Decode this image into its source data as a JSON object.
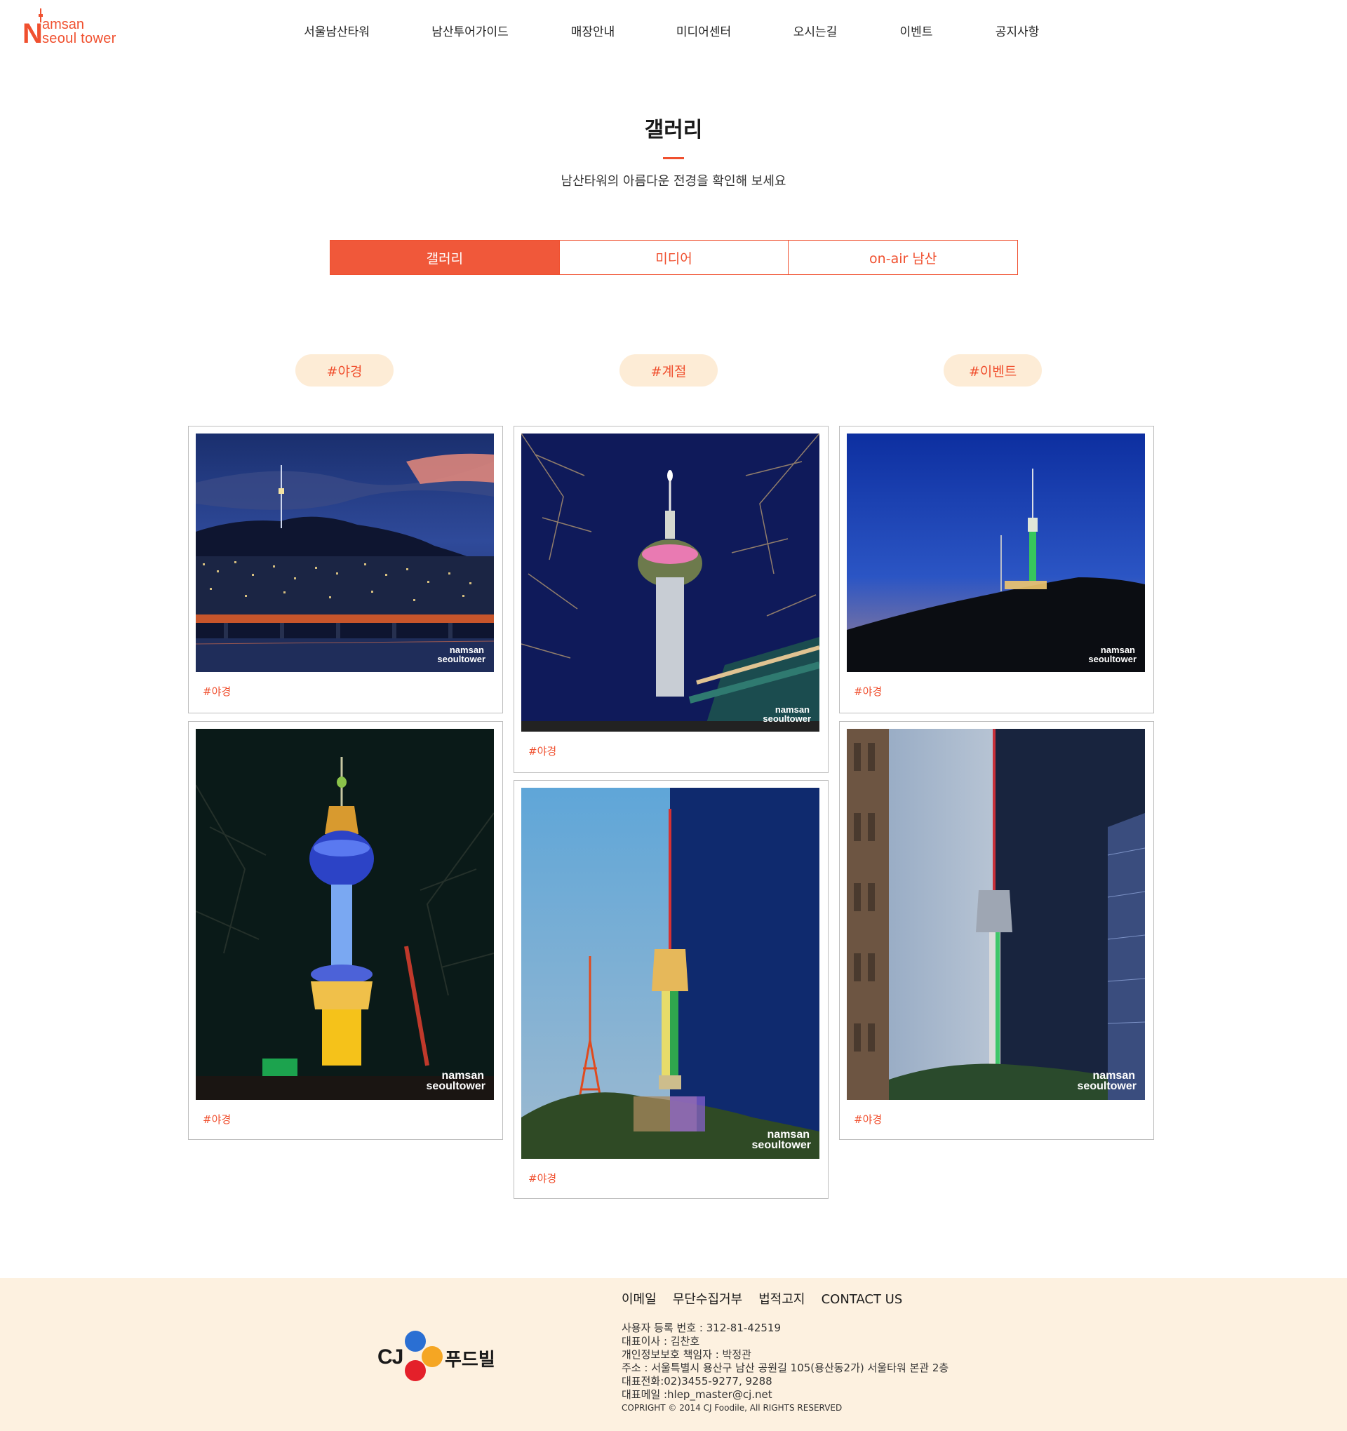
{
  "header": {
    "logo": {
      "line1": "amsan",
      "line2": "seoul tower",
      "initial": "N"
    },
    "nav": [
      "서울남산타워",
      "남산투어가이드",
      "매장안내",
      "미디어센터",
      "오시는길",
      "이벤트",
      "공지사항"
    ]
  },
  "main": {
    "title": "갤러리",
    "subtitle": "남산타워의 아름다운 전경을 확인해 보세요",
    "tabs": [
      {
        "label": "갤러리",
        "active": true
      },
      {
        "label": "미디어",
        "active": false
      },
      {
        "label": "on-air 남산",
        "active": false
      }
    ],
    "hashtags": [
      "#야경",
      "#계절",
      "#이벤트"
    ],
    "gallery": [
      {
        "tag": "#야경",
        "watermark": [
          "namsan",
          "seoultower"
        ],
        "image": "Han River bridge and Namsan tower at dusk"
      },
      {
        "tag": "#야경",
        "watermark": [
          "namsan",
          "seoultower"
        ],
        "image": "Tower between bare trees and palace eaves"
      },
      {
        "tag": "#야경",
        "watermark": [
          "namsan",
          "seoultower"
        ],
        "image": "Tower with green light at blue hour"
      },
      {
        "tag": "#야경",
        "watermark": [
          "namsan",
          "seoultower"
        ],
        "image": "Tower lit blue and yellow at night"
      },
      {
        "tag": "#야경",
        "watermark": [
          "namsan",
          "seoultower"
        ],
        "image": "Day and night split view of tower"
      },
      {
        "tag": "#야경",
        "watermark": [
          "namsan",
          "seoultower"
        ],
        "image": "Tower framed between buildings"
      }
    ]
  },
  "footer": {
    "links": [
      "이메일",
      "무단수집거부",
      "법적고지",
      "CONTACT US"
    ],
    "brand": {
      "cj": "CJ",
      "name": "푸드빌"
    },
    "info": [
      "사용자 등록 번호 : 312-81-42519",
      "대표이사 : 김찬호",
      "개인정보보호 책임자 : 박정관",
      "주소 : 서울특별시 용산구 남산 공원길 105(용산동2가) 서울타워 본관 2층",
      "대표전화:02)3455-9277, 9288",
      "대표메일 :hlep_master@cj.net"
    ],
    "copyright": "COPRIGHT © 2014 CJ Foodile, All RIGHTS RESERVED"
  },
  "colors": {
    "accent": "#f0502f",
    "pill_bg": "#fdecd6",
    "footer_bg": "#fdf1e0"
  }
}
